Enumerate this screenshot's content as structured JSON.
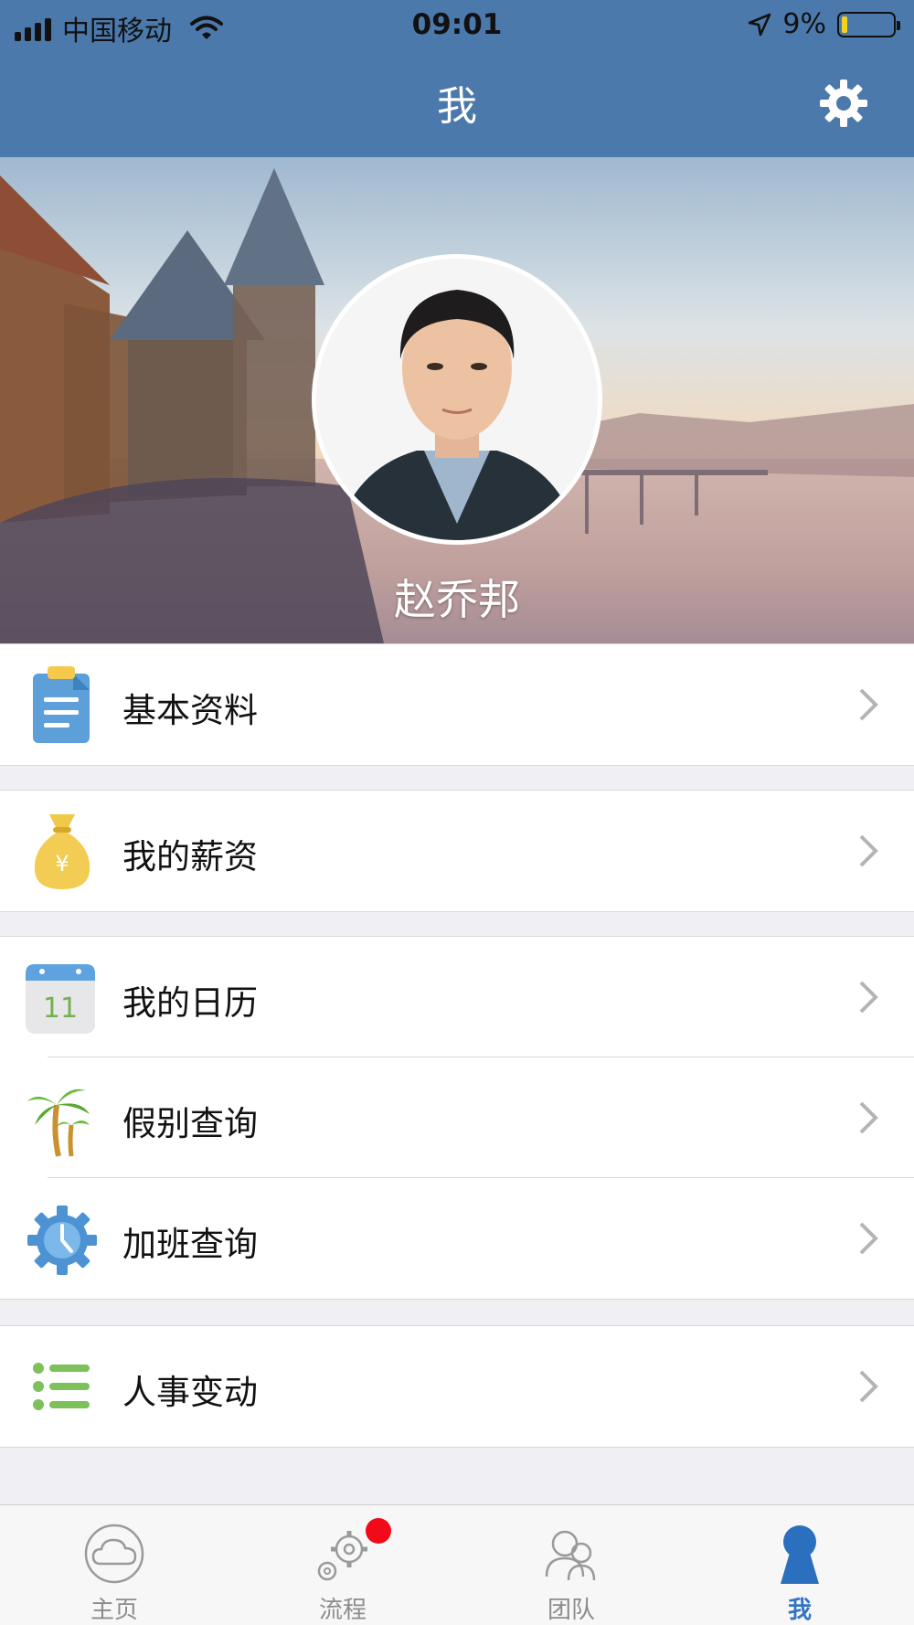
{
  "status_bar": {
    "carrier": "中国移动",
    "time": "09:01",
    "battery": "9%"
  },
  "nav": {
    "title": "我"
  },
  "profile": {
    "name": "赵乔邦"
  },
  "menu": {
    "groups": [
      {
        "items": [
          {
            "label": "基本资料",
            "icon": "clipboard-icon"
          }
        ]
      },
      {
        "items": [
          {
            "label": "我的薪资",
            "icon": "money-bag-icon"
          }
        ]
      },
      {
        "items": [
          {
            "label": "我的日历",
            "icon": "calendar-icon",
            "calendar_day": "11"
          },
          {
            "label": "假别查询",
            "icon": "palm-tree-icon"
          },
          {
            "label": "加班查询",
            "icon": "gear-clock-icon"
          }
        ]
      },
      {
        "items": [
          {
            "label": "人事变动",
            "icon": "list-icon"
          }
        ]
      }
    ]
  },
  "tabs": [
    {
      "label": "主页",
      "icon": "cloud-icon",
      "active": false
    },
    {
      "label": "流程",
      "icon": "gears-icon",
      "active": false,
      "badge": true
    },
    {
      "label": "团队",
      "icon": "team-icon",
      "active": false
    },
    {
      "label": "我",
      "icon": "person-icon",
      "active": true
    }
  ],
  "colors": {
    "nav_bar": "#4b79ab",
    "active_tab": "#3474c4",
    "badge": "#f2091a",
    "battery_level": "#f5d21c"
  }
}
